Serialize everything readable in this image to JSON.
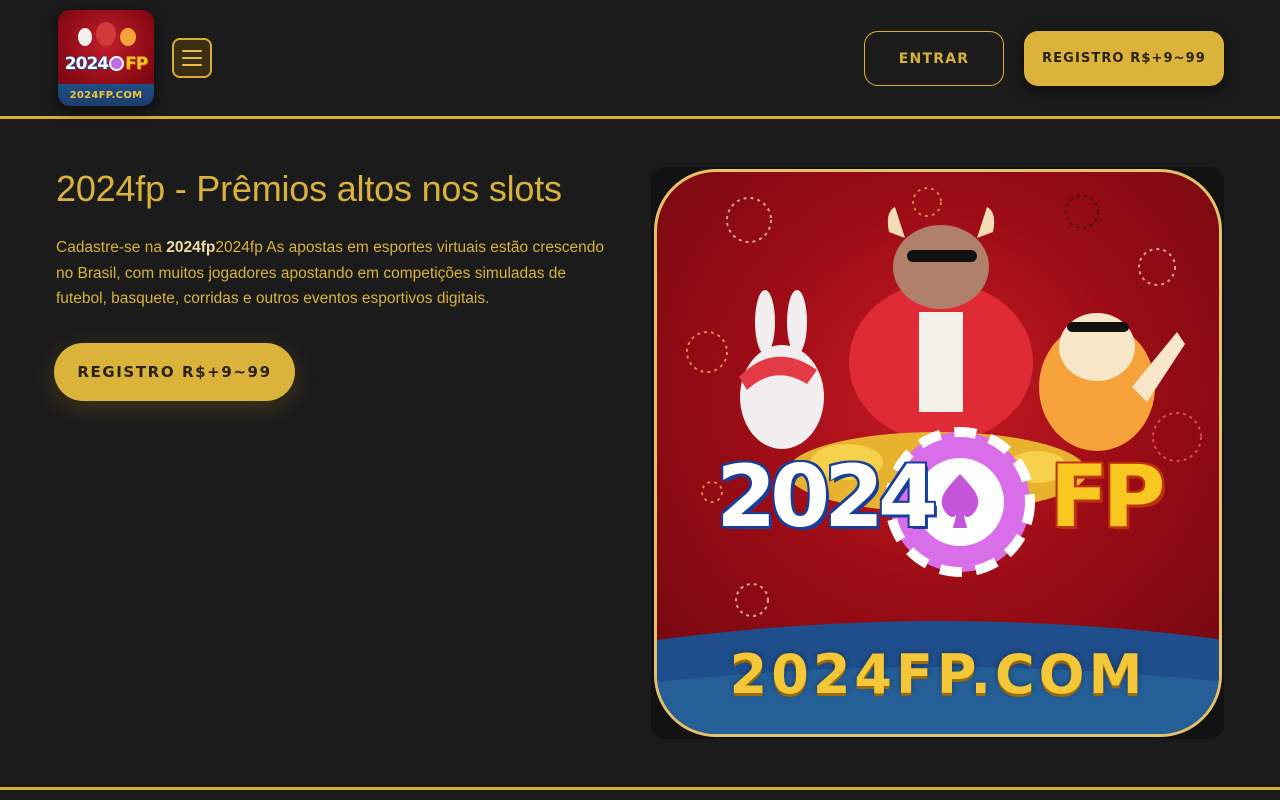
{
  "header": {
    "logo_text_left": "2024",
    "logo_text_right": "FP",
    "logo_domain": "2024FP.COM",
    "menu_icon": "hamburger-icon",
    "login_label": "ENTRAR",
    "register_label": "REGISTRO R$+9~99"
  },
  "hero": {
    "title": "2024fp - Prêmios altos nos slots",
    "desc_prefix": "Cadastre-se na ",
    "desc_brand": "2024fp",
    "desc_body": "2024fp As apostas em esportes virtuais estão crescendo no Brasil, com muitos jogadores apostando em competições simuladas de futebol, basquete, corridas e outros eventos esportivos digitais.",
    "register_label": "REGISTRO R$+9~99",
    "art_logo_left": "2024",
    "art_logo_right": "FP",
    "art_domain": "2024FP.COM"
  },
  "colors": {
    "background": "#1b1b1c",
    "accent": "#d8ae35",
    "button_fill": "#dbb33b",
    "art_red": "#9b0c15",
    "art_blue": "#1f4e8c"
  }
}
